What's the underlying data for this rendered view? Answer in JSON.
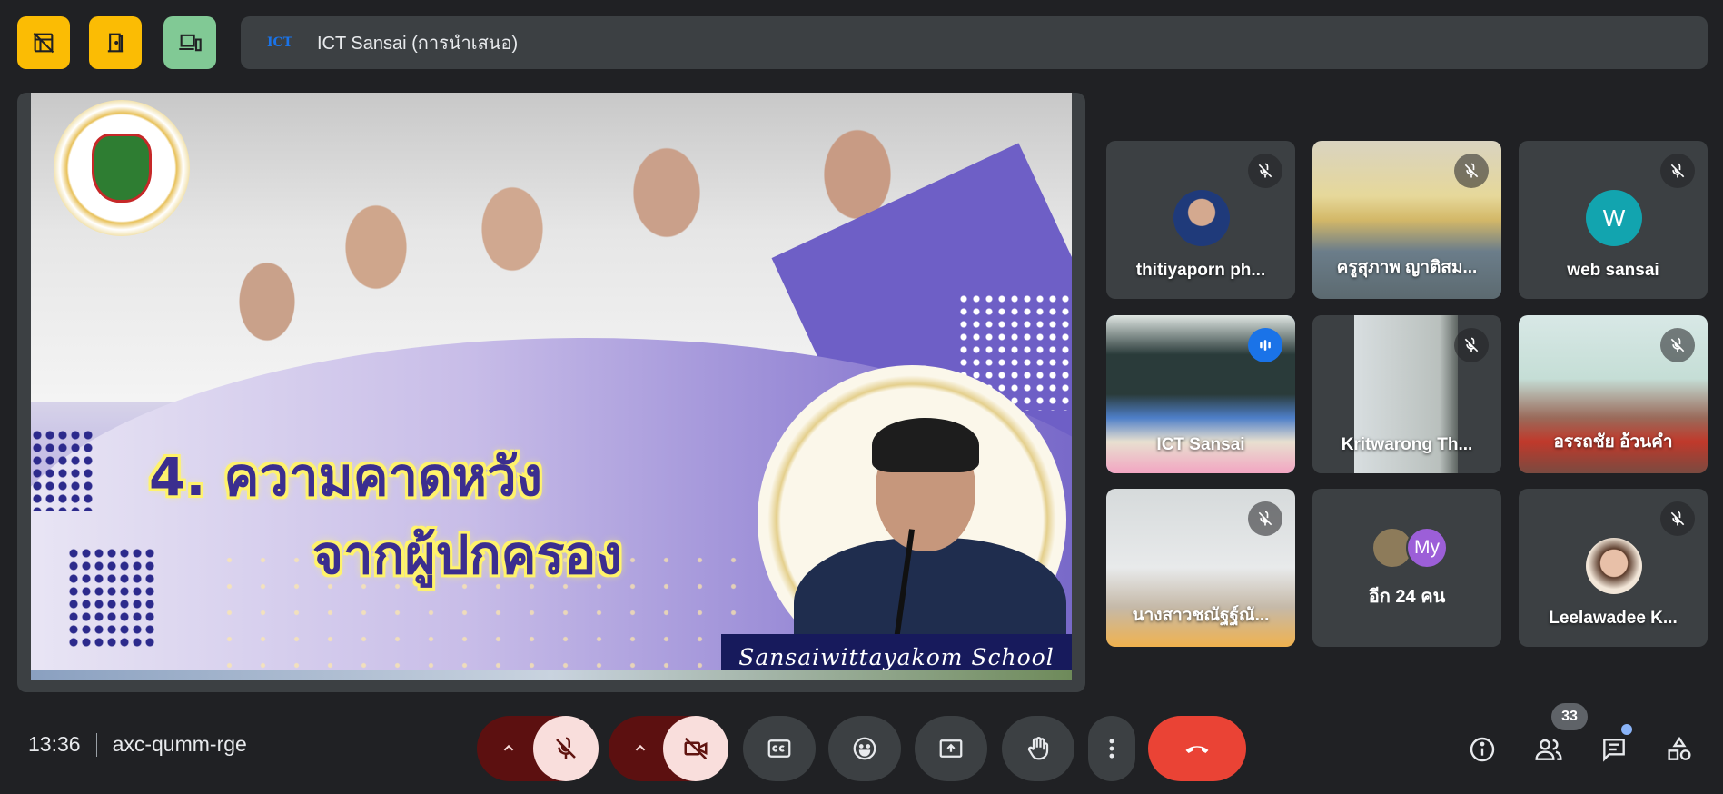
{
  "topbar": {
    "logo_text": "ICT",
    "meeting_title": "ICT Sansai (การนำเสนอ)"
  },
  "slide": {
    "headline_line1": "4. ความคาดหวัง",
    "headline_line2": "จากผู้ปกครอง",
    "school_name": "Sansaiwittayakom School"
  },
  "participants": [
    {
      "name": "thitiyaporn ph...",
      "muted": true
    },
    {
      "name": "ครูสุภาพ ญาติสม...",
      "muted": true
    },
    {
      "name": "web sansai",
      "initial": "W",
      "muted": true
    },
    {
      "name": "ICT Sansai",
      "speaking": true
    },
    {
      "name": "Kritwarong Th...",
      "muted": true
    },
    {
      "name": "อรรถชัย อ้วนคำ",
      "muted": true
    },
    {
      "name": "นางสาวชณัฐฐ์ณั...",
      "muted": true
    },
    {
      "name": "อีก 24 คน",
      "initial": "My"
    },
    {
      "name": "Leelawadee K...",
      "muted": true
    }
  ],
  "bottombar": {
    "time": "13:36",
    "meeting_code": "axc-qumm-rge",
    "people_count": "33"
  },
  "colors": {
    "accent": "#8ab4f8",
    "end_call": "#ea4335",
    "host_control": "#fbbc04",
    "companion": "#81c995"
  }
}
